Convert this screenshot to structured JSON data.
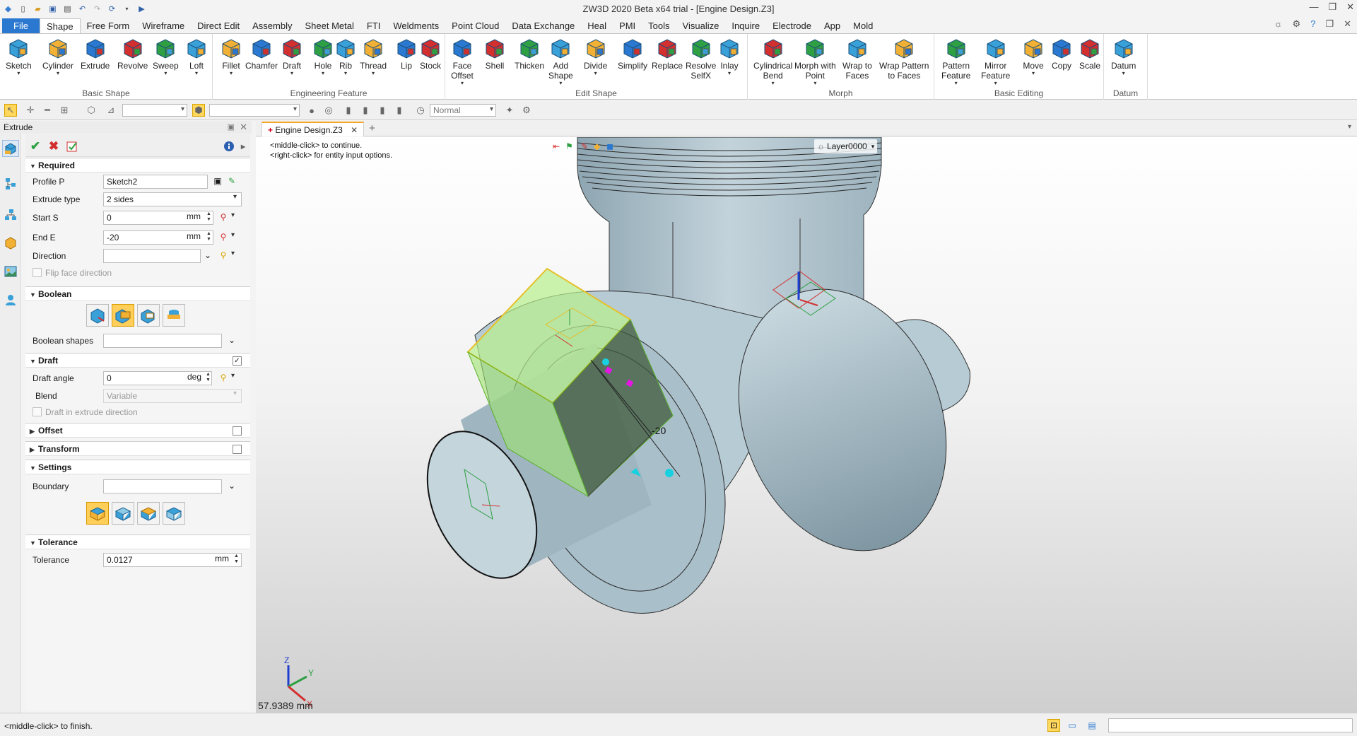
{
  "title": "ZW3D 2020 Beta x64 trial - [Engine Design.Z3]",
  "window_controls": {
    "minimize": "—",
    "restore": "❐",
    "close": "✕"
  },
  "menu": {
    "file": "File",
    "tabs": [
      "Shape",
      "Free Form",
      "Wireframe",
      "Direct Edit",
      "Assembly",
      "Sheet Metal",
      "FTI",
      "Weldments",
      "Point Cloud",
      "Data Exchange",
      "Heal",
      "PMI",
      "Tools",
      "Visualize",
      "Inquire",
      "Electrode",
      "App",
      "Mold"
    ],
    "active": "Shape"
  },
  "ribbon": {
    "groups": [
      {
        "label": "Basic Shape",
        "buttons": [
          {
            "line1": "Sketch",
            "line2": "",
            "icon": "sketch-icon",
            "dd": true
          },
          {
            "line1": "Cylinder",
            "line2": "",
            "icon": "cylinder-icon",
            "dd": true
          },
          {
            "line1": "Extrude",
            "line2": "",
            "icon": "extrude-icon",
            "dd": false
          },
          {
            "line1": "Revolve",
            "line2": "",
            "icon": "revolve-icon",
            "dd": false
          },
          {
            "line1": "Sweep",
            "line2": "",
            "icon": "sweep-icon",
            "dd": true
          },
          {
            "line1": "Loft",
            "line2": "",
            "icon": "loft-icon",
            "dd": true
          }
        ]
      },
      {
        "label": "Engineering Feature",
        "buttons": [
          {
            "line1": "Fillet",
            "line2": "",
            "icon": "fillet-icon",
            "dd": true
          },
          {
            "line1": "Chamfer",
            "line2": "",
            "icon": "chamfer-icon",
            "dd": false
          },
          {
            "line1": "Draft",
            "line2": "",
            "icon": "draft-icon",
            "dd": true
          },
          {
            "line1": "Hole",
            "line2": "",
            "icon": "hole-icon",
            "dd": true
          },
          {
            "line1": "Rib",
            "line2": "",
            "icon": "rib-icon",
            "dd": true
          },
          {
            "line1": "Thread",
            "line2": "",
            "icon": "thread-icon",
            "dd": true
          },
          {
            "line1": "Lip",
            "line2": "",
            "icon": "lip-icon",
            "dd": false
          },
          {
            "line1": "Stock",
            "line2": "",
            "icon": "stock-icon",
            "dd": false
          }
        ]
      },
      {
        "label": "Edit Shape",
        "buttons": [
          {
            "line1": "Face",
            "line2": "Offset",
            "icon": "face-offset-icon",
            "dd": true
          },
          {
            "line1": "Shell",
            "line2": "",
            "icon": "shell-icon",
            "dd": false
          },
          {
            "line1": "Thicken",
            "line2": "",
            "icon": "thicken-icon",
            "dd": false
          },
          {
            "line1": "Add",
            "line2": "Shape",
            "icon": "add-shape-icon",
            "dd": true
          },
          {
            "line1": "Divide",
            "line2": "",
            "icon": "divide-icon",
            "dd": true
          },
          {
            "line1": "Simplify",
            "line2": "",
            "icon": "simplify-icon",
            "dd": false
          },
          {
            "line1": "Replace",
            "line2": "",
            "icon": "replace-icon",
            "dd": false
          },
          {
            "line1": "Resolve",
            "line2": "SelfX",
            "icon": "resolve-selfx-icon",
            "dd": false
          },
          {
            "line1": "Inlay",
            "line2": "",
            "icon": "inlay-icon",
            "dd": true
          }
        ]
      },
      {
        "label": "Morph",
        "buttons": [
          {
            "line1": "Cylindrical",
            "line2": "Bend",
            "icon": "cylindrical-bend-icon",
            "dd": true
          },
          {
            "line1": "Morph with",
            "line2": "Point",
            "icon": "morph-point-icon",
            "dd": true
          },
          {
            "line1": "Wrap to",
            "line2": "Faces",
            "icon": "wrap-faces-icon",
            "dd": false
          },
          {
            "line1": "Wrap Pattern",
            "line2": "to Faces",
            "icon": "wrap-pattern-icon",
            "dd": false
          }
        ]
      },
      {
        "label": "Basic Editing",
        "buttons": [
          {
            "line1": "Pattern",
            "line2": "Feature",
            "icon": "pattern-feature-icon",
            "dd": true
          },
          {
            "line1": "Mirror",
            "line2": "Feature",
            "icon": "mirror-feature-icon",
            "dd": true
          },
          {
            "line1": "Move",
            "line2": "",
            "icon": "move-icon",
            "dd": true
          },
          {
            "line1": "Copy",
            "line2": "",
            "icon": "copy-icon",
            "dd": false
          },
          {
            "line1": "Scale",
            "line2": "",
            "icon": "scale-icon",
            "dd": false
          }
        ]
      },
      {
        "label": "Datum",
        "buttons": [
          {
            "line1": "Datum",
            "line2": "",
            "icon": "datum-icon",
            "dd": true
          }
        ]
      }
    ]
  },
  "toolbar2": {
    "render_mode": "Normal"
  },
  "panel": {
    "title": "Extrude",
    "sections": {
      "required": "Required",
      "boolean": "Boolean",
      "draft": "Draft",
      "offset": "Offset",
      "transform": "Transform",
      "settings": "Settings",
      "tolerance": "Tolerance"
    },
    "fields": {
      "profile_label": "Profile P",
      "profile_value": "Sketch2",
      "extrude_type_label": "Extrude type",
      "extrude_type_value": "2 sides",
      "start_label": "Start S",
      "start_value": "0",
      "start_unit": "mm",
      "end_label": "End E",
      "end_value": "-20",
      "end_unit": "mm",
      "direction_label": "Direction",
      "direction_value": "",
      "flip_label": "Flip face direction",
      "boolean_shapes_label": "Boolean shapes",
      "draft_angle_label": "Draft angle",
      "draft_angle_value": "0",
      "draft_angle_unit": "deg",
      "blend_label": "Blend",
      "blend_value": "Variable",
      "draft_in_dir_label": "Draft in extrude direction",
      "boundary_label": "Boundary",
      "tolerance_label": "Tolerance",
      "tolerance_value": "0.0127",
      "tolerance_unit": "mm"
    },
    "draft_checked": "✓"
  },
  "doc_tab": {
    "label": "Engine Design.Z3"
  },
  "viewport": {
    "hint1": "<middle-click> to continue.",
    "hint2": "<right-click> for entity input options.",
    "layer": "Layer0000",
    "dim_label": "-20",
    "readout": "57.9389 mm",
    "axis_z": "Z",
    "axis_y": "Y",
    "axis_x": "X"
  },
  "status": {
    "message": "<middle-click> to finish."
  },
  "colors": {
    "accent": "#2b78d0",
    "highlight": "#ffd75c",
    "preview_green": "#9ee36e",
    "part_body": "#b3c7d1"
  }
}
